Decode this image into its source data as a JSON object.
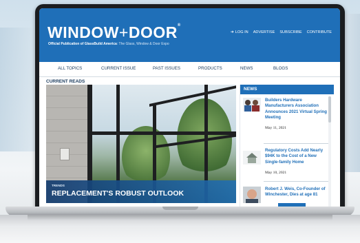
{
  "site": {
    "logo_main": "WINDOW",
    "logo_plus": "+",
    "logo_second": "DOOR",
    "logo_reg": "®",
    "tagline_bold": "Official Publication of GlassBuild America",
    "tagline_rest": ": The Glass, Window & Door Expo"
  },
  "top_nav": [
    "LOG IN",
    "ADVERTISE",
    "SUBSCRIBE",
    "CONTRIBUTE"
  ],
  "main_nav": [
    "ALL TOPICS",
    "CURRENT ISSUE",
    "PAST ISSUES",
    "PRODUCTS",
    "NEWS",
    "BLOGS"
  ],
  "section_label": "CURRENT READS",
  "hero": {
    "kicker": "TRENDS",
    "title": "REPLACEMENT'S ROBUST OUTLOOK"
  },
  "news": {
    "header": "NEWS",
    "items": [
      {
        "title": "Builders Hardware Manufacturers Association Announces 2021 Virtual Spring Meeting",
        "date": "May 11, 2021"
      },
      {
        "title": "Regulatory Costs Add Nearly $94K to the Cost of a New Single-family Home",
        "date": "May 10, 2021"
      },
      {
        "title": "Robert J. Weis, Co-Founder of Winchester, Dies at age 81",
        "date": ""
      }
    ]
  },
  "colors": {
    "brand_blue": "#1f6fb8",
    "nav_text": "#1a3a5c"
  }
}
